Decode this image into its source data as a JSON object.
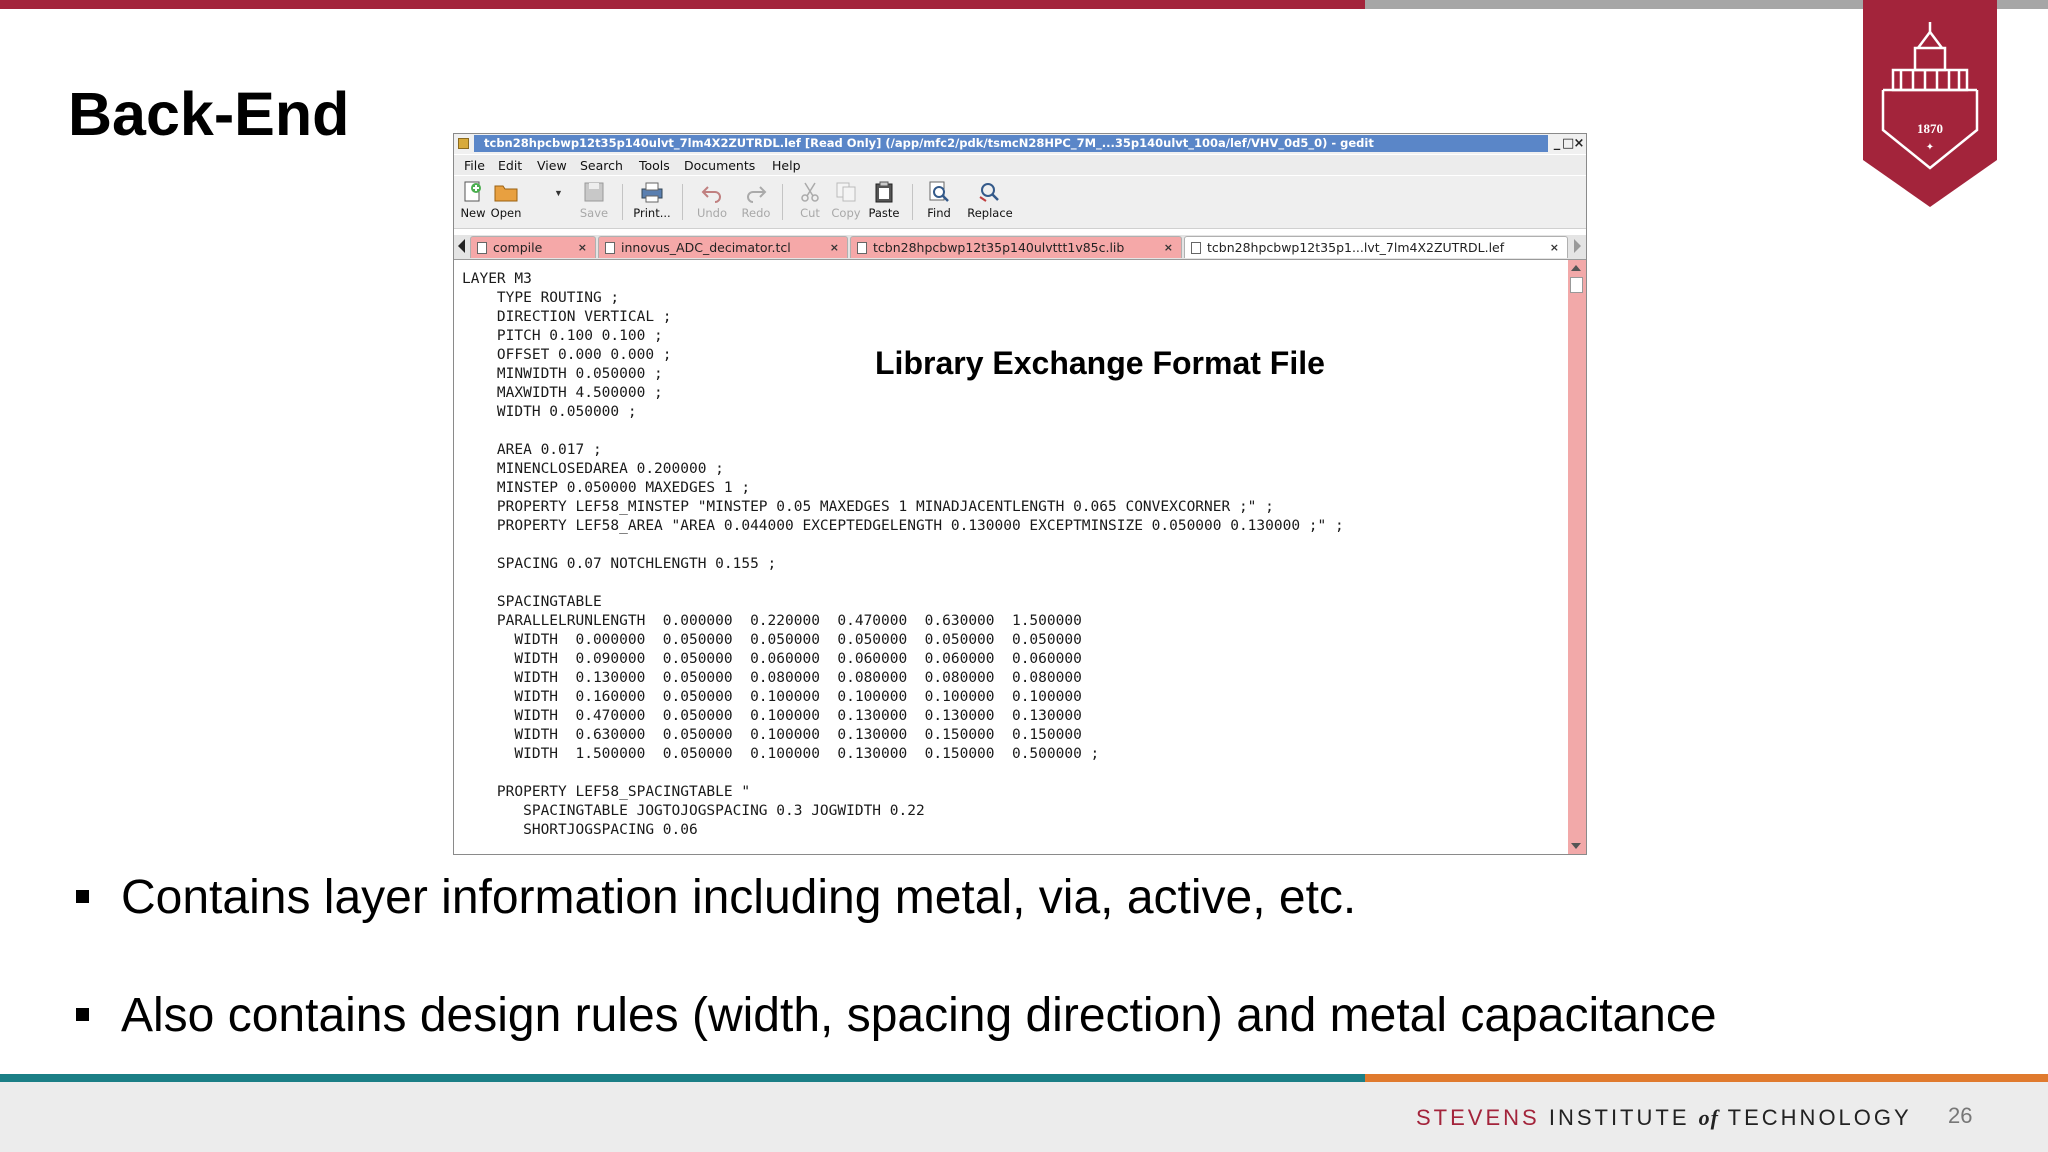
{
  "slide": {
    "title": "Back-End",
    "page_number": "26",
    "brand": {
      "part1": "STEVENS",
      "part2": "INSTITUTE",
      "part3": "of",
      "part4": "TECHNOLOGY"
    },
    "seal_year": "1870",
    "bullets": [
      "Contains layer information including metal, via, active, etc.",
      "Also contains design rules (width, spacing direction) and metal capacitance"
    ],
    "overlay_label": "Library Exchange Format File",
    "colors": {
      "red": "#a3243b",
      "gray": "#a6a6a6",
      "teal": "#1b7f86",
      "orange": "#e07a2e"
    }
  },
  "editor": {
    "window_title": "tcbn28hpcbwp12t35p140ulvt_7lm4X2ZUTRDL.lef [Read Only] (/app/mfc2/pdk/tsmcN28HPC_7M_...35p140ulvt_100a/lef/VHV_0d5_0) - gedit",
    "window_controls": [
      "_",
      "□",
      "×"
    ],
    "menu": [
      "File",
      "Edit",
      "View",
      "Search",
      "Tools",
      "Documents",
      "Help"
    ],
    "toolbar": {
      "new": "New",
      "open": "Open",
      "save": "Save",
      "print": "Print...",
      "undo": "Undo",
      "redo": "Redo",
      "cut": "Cut",
      "copy": "Copy",
      "paste": "Paste",
      "find": "Find",
      "replace": "Replace"
    },
    "tabs": [
      {
        "label": "compile",
        "close": "×"
      },
      {
        "label": "innovus_ADC_decimator.tcl",
        "close": "×"
      },
      {
        "label": "tcbn28hpcbwp12t35p140ulvttt1v85c.lib",
        "close": "×"
      },
      {
        "label": "tcbn28hpcbwp12t35p1...lvt_7lm4X2ZUTRDL.lef",
        "close": "×"
      }
    ],
    "code": "LAYER M3\n    TYPE ROUTING ;\n    DIRECTION VERTICAL ;\n    PITCH 0.100 0.100 ;\n    OFFSET 0.000 0.000 ;\n    MINWIDTH 0.050000 ;\n    MAXWIDTH 4.500000 ;\n    WIDTH 0.050000 ;\n\n    AREA 0.017 ;\n    MINENCLOSEDAREA 0.200000 ;\n    MINSTEP 0.050000 MAXEDGES 1 ;\n    PROPERTY LEF58_MINSTEP \"MINSTEP 0.05 MAXEDGES 1 MINADJACENTLENGTH 0.065 CONVEXCORNER ;\" ;\n    PROPERTY LEF58_AREA \"AREA 0.044000 EXCEPTEDGELENGTH 0.130000 EXCEPTMINSIZE 0.050000 0.130000 ;\" ;\n\n    SPACING 0.07 NOTCHLENGTH 0.155 ;\n\n    SPACINGTABLE\n    PARALLELRUNLENGTH  0.000000  0.220000  0.470000  0.630000  1.500000\n      WIDTH  0.000000  0.050000  0.050000  0.050000  0.050000  0.050000\n      WIDTH  0.090000  0.050000  0.060000  0.060000  0.060000  0.060000\n      WIDTH  0.130000  0.050000  0.080000  0.080000  0.080000  0.080000\n      WIDTH  0.160000  0.050000  0.100000  0.100000  0.100000  0.100000\n      WIDTH  0.470000  0.050000  0.100000  0.130000  0.130000  0.130000\n      WIDTH  0.630000  0.050000  0.100000  0.130000  0.150000  0.150000\n      WIDTH  1.500000  0.050000  0.100000  0.130000  0.150000  0.500000 ;\n\n    PROPERTY LEF58_SPACINGTABLE \"\n       SPACINGTABLE JOGTOJOGSPACING 0.3 JOGWIDTH 0.22\n       SHORTJOGSPACING 0.06"
  }
}
